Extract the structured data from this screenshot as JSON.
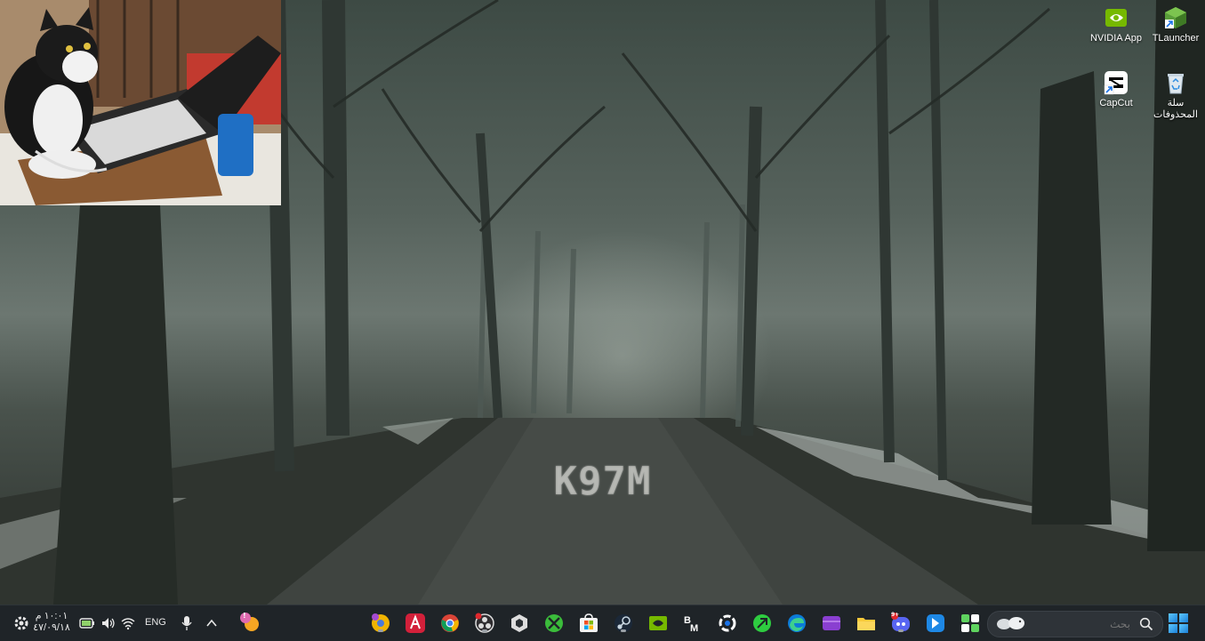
{
  "desktop": {
    "watermark": "K97M",
    "icons": [
      {
        "label": "NVIDIA App",
        "icon": "nvidia-app-icon"
      },
      {
        "label": "TLauncher",
        "icon": "tlauncher-icon"
      },
      {
        "label": "CapCut",
        "icon": "capcut-icon"
      },
      {
        "label": "سلة المحذوفات",
        "icon": "recycle-bin-icon"
      }
    ]
  },
  "taskbar": {
    "search_placeholder": "بحث",
    "language": "ENG",
    "time": "١٠:٠١ م",
    "date": "٤٧/٠٩/١٨",
    "notification_badge": "!",
    "apps": [
      "chrome-canary-icon",
      "arc-red-icon",
      "chrome-icon",
      "obs-icon",
      "unity-icon",
      "xbox-icon",
      "microsoft-store-icon",
      "steam-icon",
      "nvidia-icon",
      "bm-icon",
      "circle-app-icon",
      "green-app-icon",
      "edge-icon",
      "purple-app-icon",
      "file-explorer-icon",
      "discord-icon",
      "blue-app-icon",
      "capcut-taskbar-icon"
    ],
    "discord_badge": "9+"
  },
  "colors": {
    "taskbar_bg": "#1f2428",
    "accent": "#1b7fd6"
  }
}
